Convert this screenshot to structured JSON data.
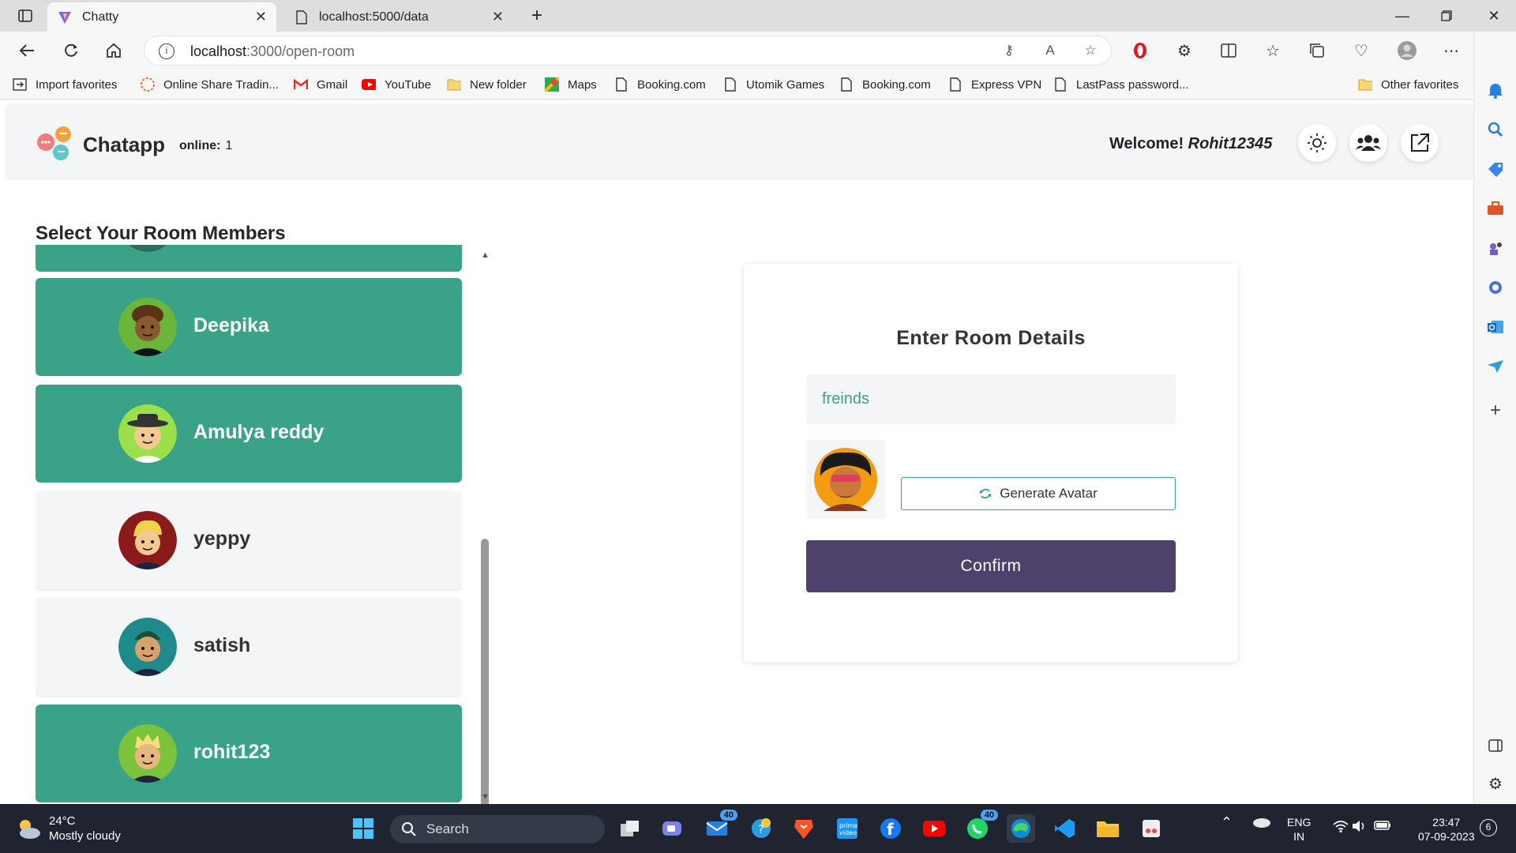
{
  "browser": {
    "tabs": [
      {
        "title": "Chatty",
        "active": true
      },
      {
        "title": "localhost:5000/data",
        "active": false
      }
    ],
    "address": {
      "host": "localhost",
      "rest": ":3000/open-room"
    },
    "bookmarks": [
      {
        "label": "Import favorites",
        "icon": "import-icon"
      },
      {
        "label": "Online Share Tradin...",
        "icon": "trading-icon"
      },
      {
        "label": "Gmail",
        "icon": "gmail-icon"
      },
      {
        "label": "YouTube",
        "icon": "youtube-icon"
      },
      {
        "label": "New folder",
        "icon": "folder-icon"
      },
      {
        "label": "Maps",
        "icon": "maps-icon"
      },
      {
        "label": "Booking.com",
        "icon": "page-icon"
      },
      {
        "label": "Utomik Games",
        "icon": "page-icon"
      },
      {
        "label": "Booking.com",
        "icon": "page-icon"
      },
      {
        "label": "Express VPN",
        "icon": "page-icon"
      },
      {
        "label": "LastPass password...",
        "icon": "page-icon"
      }
    ],
    "other_favorites": "Other favorites"
  },
  "app": {
    "brand": "Chatapp",
    "online_label": "online:",
    "online_count": "1",
    "welcome_label": "Welcome!",
    "username": "Rohit12345",
    "section_title": "Select Your Room Members",
    "members": [
      {
        "name": "",
        "selected": true,
        "avatar_color": "#2f6d5f"
      },
      {
        "name": "Deepika",
        "selected": true,
        "avatar_color": "#6bb53a"
      },
      {
        "name": "Amulya reddy",
        "selected": true,
        "avatar_color": "#9be04b"
      },
      {
        "name": "yeppy",
        "selected": false,
        "avatar_color": "#8b1a1a"
      },
      {
        "name": "satish",
        "selected": false,
        "avatar_color": "#1f8a8a"
      },
      {
        "name": "rohit123",
        "selected": true,
        "avatar_color": "#7cc23a"
      }
    ],
    "room_card": {
      "title": "Enter Room Details",
      "room_name_value": "freinds",
      "generate_label": "Generate Avatar",
      "confirm_label": "Confirm"
    },
    "colors": {
      "accent": "#3aa387",
      "confirm": "#4e416b"
    }
  },
  "taskbar": {
    "temperature": "24°C",
    "weather": "Mostly cloudy",
    "search_placeholder": "Search",
    "language": "ENG",
    "region": "IN",
    "time": "23:47",
    "date": "07-09-2023",
    "notification_count": "6",
    "mail_badge": "40",
    "whatsapp_badge": "40"
  }
}
